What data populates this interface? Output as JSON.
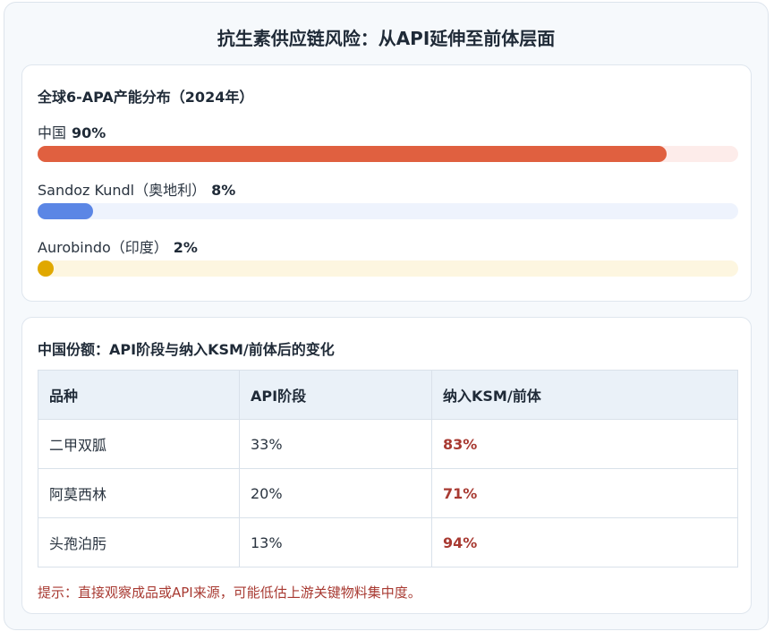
{
  "title": "抗生素供应链风险：从API延伸至前体层面",
  "distribution": {
    "title": "全球6-APA产能分布（2024年）",
    "items": [
      {
        "label": "中国",
        "pct_text": "90%",
        "value": 90,
        "color": "#e06040",
        "track": "#fdecea"
      },
      {
        "label": "Sandoz Kundl（奥地利）",
        "pct_text": "8%",
        "value": 8,
        "color": "#5b86e5",
        "track": "#eef3fd"
      },
      {
        "label": "Aurobindo（印度）",
        "pct_text": "2%",
        "value": 2,
        "color": "#e0a800",
        "track": "#fdf6e0"
      }
    ]
  },
  "chart_data": {
    "type": "bar",
    "categories": [
      "中国",
      "Sandoz Kundl（奥地利）",
      "Aurobindo（印度）"
    ],
    "values": [
      90,
      8,
      2
    ],
    "title": "全球6-APA产能分布（2024年）",
    "xlabel": "",
    "ylabel": "",
    "ylim": [
      0,
      100
    ]
  },
  "share_table": {
    "title": "中国份额：API阶段与纳入KSM/前体后的变化",
    "headers": [
      "品种",
      "API阶段",
      "纳入KSM/前体"
    ],
    "rows": [
      [
        "二甲双胍",
        "33%",
        "83%"
      ],
      [
        "阿莫西林",
        "20%",
        "71%"
      ],
      [
        "头孢泊肟",
        "13%",
        "94%"
      ]
    ],
    "tip": "提示：直接观察成品或API来源，可能低估上游关键物料集中度。"
  }
}
